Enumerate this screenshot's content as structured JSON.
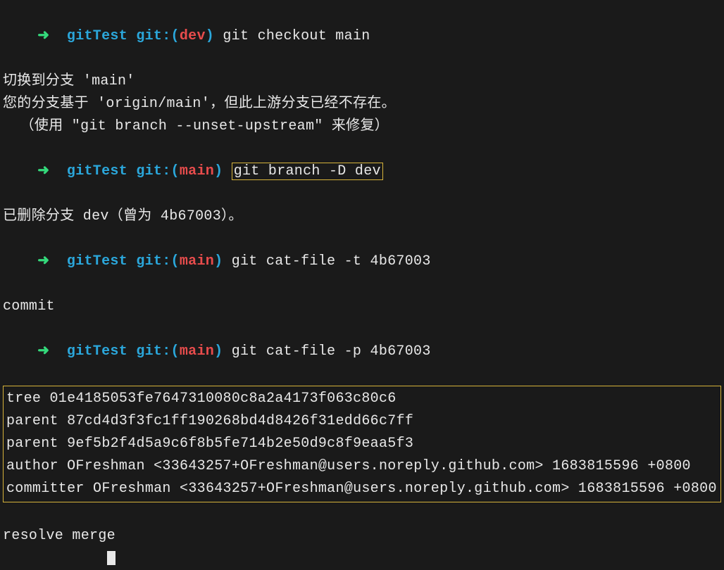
{
  "prompts": {
    "arrow": "➜",
    "folder": "gitTest",
    "gitPrefix": "git:(",
    "gitSuffix": ")",
    "branchDev": "dev",
    "branchMain": "main"
  },
  "lines": {
    "l1_cmd": "git checkout main",
    "l2": "切换到分支 'main'",
    "l3": "您的分支基于 'origin/main'，但此上游分支已经不存在。",
    "l4": "  （使用 \"git branch --unset-upstream\" 来修复）",
    "l5_cmd_boxed": "git branch -D dev",
    "l6": "已删除分支 dev（曾为 4b67003）。",
    "l7_cmd": "git cat-file -t 4b67003",
    "l8": "commit",
    "l9_cmd": "git cat-file -p 4b67003",
    "block": {
      "a": "tree 01e4185053fe7647310080c8a2a4173f063c80c6",
      "b": "parent 87cd4d3f3fc1ff190268bd4d8426f31edd66c7ff",
      "c": "parent 9ef5b2f4d5a9c6f8b5fe714b2e50d9c8f9eaa5f3",
      "d": "author OFreshman <33643257+OFreshman@users.noreply.github.com> 1683815596 +0800",
      "e": "committer OFreshman <33643257+OFreshman@users.noreply.github.com> 1683815596 +0800"
    },
    "l_blank": " ",
    "l_final": "resolve merge"
  }
}
